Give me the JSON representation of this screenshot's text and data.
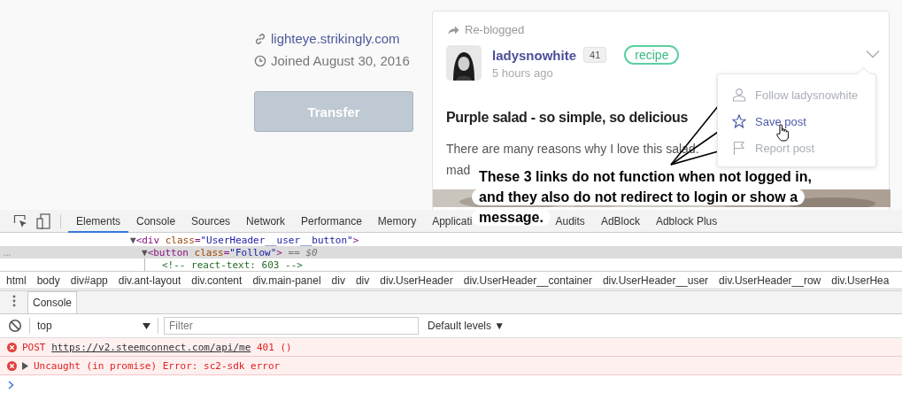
{
  "profile": {
    "website": "lighteye.strikingly.com",
    "joined": "Joined August 30, 2016",
    "transfer_button": "Transfer"
  },
  "post": {
    "reblogged": "Re-blogged",
    "author": "ladysnowhite",
    "reputation": "41",
    "tag": "recipe",
    "time": "5 hours ago",
    "title": "Purple salad - so simple, so delicious",
    "body_lines": [
      "There are many reasons why I love this salad.",
      "mad"
    ],
    "image": {
      "kind": "picture"
    },
    "menu": [
      {
        "label": "Follow ladysnowhite",
        "highlighted": false
      },
      {
        "label": "Save post",
        "highlighted": true
      },
      {
        "label": "Report post",
        "highlighted": false
      }
    ]
  },
  "annotation": {
    "text": "These 3 links do not function when not logged in, and they also do not redirect to login or show a message."
  },
  "devtools": {
    "tabs": [
      {
        "label": "Elements",
        "selected": true
      },
      {
        "label": "Console",
        "selected": false
      },
      {
        "label": "Sources",
        "selected": false
      },
      {
        "label": "Network",
        "selected": false
      },
      {
        "label": "Performance",
        "selected": false
      },
      {
        "label": "Memory",
        "selected": false
      },
      {
        "label": "Applicati",
        "selected": false
      },
      {
        "label": "Audits",
        "selected": false
      },
      {
        "label": "AdBlock",
        "selected": false
      },
      {
        "label": "Adblock Plus",
        "selected": false
      }
    ],
    "dom_tree": [
      {
        "selected": false,
        "parts": [
          {
            "kind": "tri",
            "text": "▼"
          },
          {
            "kind": "tag",
            "text": "<div "
          },
          {
            "kind": "attr",
            "text": "class"
          },
          {
            "kind": "tag",
            "text": "="
          },
          {
            "kind": "value",
            "text": "\"UserHeader__user__button\""
          },
          {
            "kind": "tag",
            "text": ">"
          }
        ],
        "children": [
          {
            "selected": true,
            "gutter": "...",
            "parts": [
              {
                "kind": "tri",
                "text": "▼"
              },
              {
                "kind": "tag",
                "text": "<button "
              },
              {
                "kind": "attr",
                "text": "class"
              },
              {
                "kind": "tag",
                "text": "="
              },
              {
                "kind": "value",
                "text": "\"Follow\""
              },
              {
                "kind": "tag",
                "text": ">"
              },
              {
                "kind": "ref",
                "text": " == $0"
              }
            ],
            "children": [
              {
                "selected": false,
                "parts": [
                  {
                    "kind": "comment",
                    "text": "<!-- react-text: 603 -->"
                  }
                ]
              }
            ]
          }
        ]
      }
    ],
    "breadcrumbs": [
      "html",
      "body",
      "div#app",
      "div.ant-layout",
      "div.content",
      "div.main-panel",
      "div",
      "div",
      "div.UserHeader",
      "div.UserHeader__container",
      "div.UserHeader__user",
      "div.UserHeader__row",
      "div.UserHea"
    ],
    "drawer_tab": {
      "label": "Console",
      "selected": true
    },
    "console_toolbar": {
      "context": "top",
      "filter_placeholder": "Filter",
      "levels": "Default levels ▼"
    },
    "messages": [
      {
        "kind": "error",
        "expandable": false,
        "prefix": "POST ",
        "link": "https://v2.steemconnect.com/api/me",
        "suffix": " 401 ()"
      },
      {
        "kind": "error",
        "expandable": true,
        "prefix": "Uncaught (in promise) Error: sc2-sdk error"
      }
    ]
  }
}
